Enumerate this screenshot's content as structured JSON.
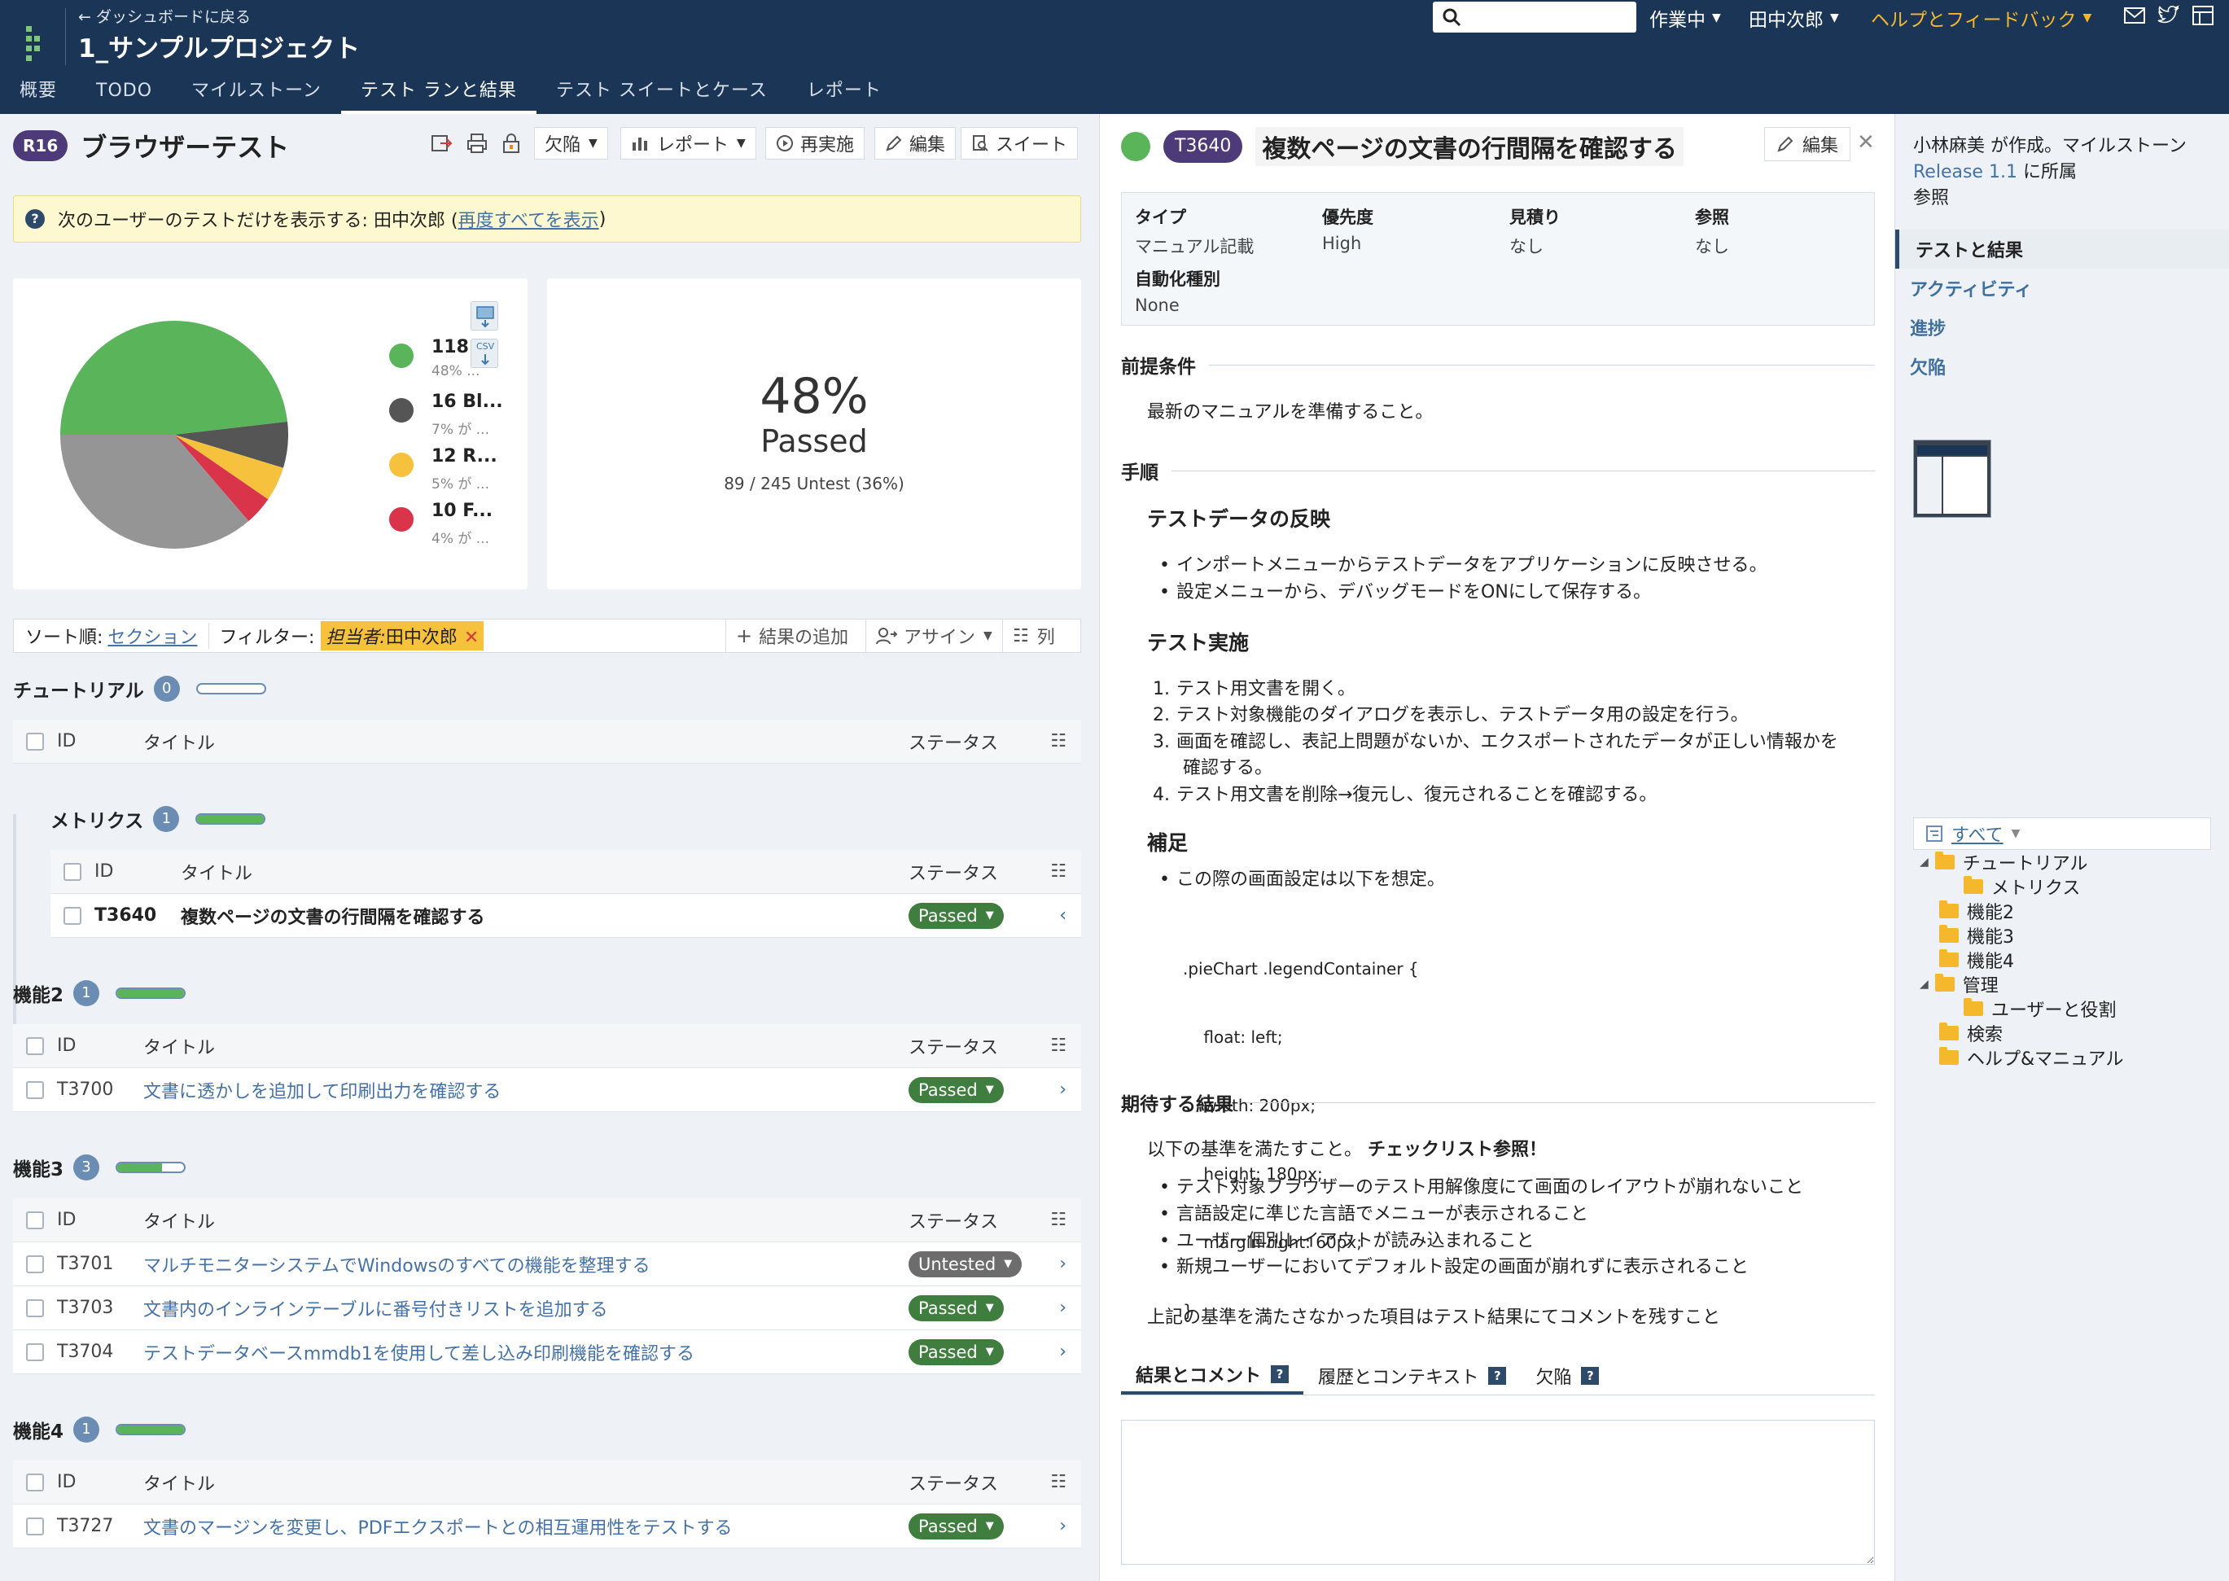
{
  "header": {
    "back": "← ダッシュボードに戻る",
    "project": "1_サンプルプロジェクト",
    "search_placeholder": "",
    "status": "作業中",
    "user": "田中次郎",
    "help": "ヘルプとフィードバック",
    "tabs": [
      "概要",
      "TODO",
      "マイルストーン",
      "テスト ランと結果",
      "テスト スイートとケース",
      "レポート"
    ]
  },
  "run": {
    "badge": "R16",
    "title": "ブラウザーテスト",
    "toolbar": {
      "defects": "欠陥",
      "report": "レポート",
      "rerun": "再実施",
      "edit": "編集",
      "suite": "スイート"
    },
    "notice_prefix": "次のユーザーのテストだけを表示する: 田中次郎 (",
    "notice_link": "再度すべてを表示",
    "notice_suffix": ")"
  },
  "chart_data": {
    "type": "pie",
    "slices": [
      {
        "label": "118 ...",
        "sub": "48% ...",
        "value": 118,
        "percent": 48,
        "color": "#5ab55a"
      },
      {
        "label": "16 Bl...",
        "sub": "7% が ...",
        "value": 16,
        "percent": 7,
        "color": "#555555"
      },
      {
        "label": "12 R...",
        "sub": "5% が ...",
        "value": 12,
        "percent": 5,
        "color": "#f6c23e"
      },
      {
        "label": "10 F...",
        "sub": "4% が ...",
        "value": 10,
        "percent": 4,
        "color": "#d9344a"
      },
      {
        "label": "",
        "sub": "",
        "value": 89,
        "percent": 36,
        "color": "#959595"
      }
    ],
    "export_labels": [
      "",
      "CSV"
    ]
  },
  "stats": {
    "percent": "48%",
    "label": "Passed",
    "untested": "89 / 245 Untest (36%)"
  },
  "filters": {
    "sort_label": "ソート順:",
    "sort_value": "セクション",
    "filter_label": "フィルター:",
    "chip_key": "担当者:",
    "chip_value": "田中次郎",
    "add_result": "結果の追加",
    "assign": "アサイン",
    "columns": "列"
  },
  "table_headers": {
    "id": "ID",
    "title": "タイトル",
    "status": "ステータス"
  },
  "sections": [
    {
      "name": "チュートリアル",
      "count": "0",
      "progress": 0,
      "rows": []
    },
    {
      "name": "メトリクス",
      "count": "1",
      "progress": 100,
      "rows": [
        {
          "id": "T3640",
          "title": "複数ページの文書の行間隔を確認する",
          "status": "Passed"
        }
      ]
    },
    {
      "name": "機能2",
      "count": "1",
      "progress": 100,
      "rows": [
        {
          "id": "T3700",
          "title": "文書に透かしを追加して印刷出力を確認する",
          "status": "Passed"
        }
      ]
    },
    {
      "name": "機能3",
      "count": "3",
      "progress": 67,
      "rows": [
        {
          "id": "T3701",
          "title": "マルチモニターシステムでWindowsのすべての機能を整理する",
          "status": "Untested"
        },
        {
          "id": "T3703",
          "title": "文書内のインラインテーブルに番号付きリストを追加する",
          "status": "Passed"
        },
        {
          "id": "T3704",
          "title": "テストデータベースmmdb1を使用して差し込み印刷機能を確認する",
          "status": "Passed"
        }
      ]
    },
    {
      "name": "機能4",
      "count": "1",
      "progress": 100,
      "rows": [
        {
          "id": "T3727",
          "title": "文書のマージンを変更し、PDFエクスポートとの相互運用性をテストする",
          "status": "Passed"
        }
      ]
    }
  ],
  "test": {
    "id": "T3640",
    "title": "複数ページの文書の行間隔を確認する",
    "edit": "編集",
    "props": [
      {
        "k": "タイプ",
        "v": "マニュアル記載"
      },
      {
        "k": "優先度",
        "v": "High"
      },
      {
        "k": "見積り",
        "v": "なし"
      },
      {
        "k": "参照",
        "v": "なし"
      },
      {
        "k": "自動化種別",
        "v": "None"
      }
    ],
    "precond_h": "前提条件",
    "precond": "最新のマニュアルを準備すること。",
    "steps_h": "手順",
    "sub1": "テストデータの反映",
    "sub1_items": [
      "インポートメニューからテストデータをアプリケーションに反映させる。",
      "設定メニューから、デバッグモードをONにして保存する。"
    ],
    "sub2": "テスト実施",
    "sub2_items": [
      "テスト用文書を開く。",
      "テスト対象機能のダイアログを表示し、テストデータ用の設定を行う。",
      "画面を確認し、表記上問題がないか、エクスポートされたデータが正しい情報かを",
      "確認する。",
      "テスト用文書を削除→復元し、復元されることを確認する。"
    ],
    "sub3": "補足",
    "sub3_item": "この際の画面設定は以下を想定。",
    "code": [
      ".pieChart .legendContainer {",
      "    float: left;",
      "    width: 200px;",
      "    height: 180px;",
      "    margin-right: 60px;",
      "}"
    ],
    "expected_h": "期待する結果",
    "expected_intro": "以下の基準を満たすこと。",
    "expected_bold": "チェックリスト参照！",
    "expected_items": [
      "テスト対象ブラウザーのテスト用解像度にて画面のレイアウトが崩れないこと",
      "言語設定に準じた言語でメニューが表示されること",
      "ユーザー個別レイアウトが読み込まれること",
      "新規ユーザーにおいてデフォルト設定の画面が崩れずに表示されること"
    ],
    "expected_note": "上記の基準を満たさなかった項目はテスト結果にてコメントを残すこと",
    "result_tabs": [
      "結果とコメント",
      "履歴とコンテキスト",
      "欠陥"
    ],
    "q": "?"
  },
  "sidebar": {
    "info1": "小林麻美 が作成。マイルストーン",
    "info_link": "Release 1.1",
    "info2": " に所属",
    "info3": "参照",
    "nav": [
      "テストと結果",
      "アクティビティ",
      "進捗",
      "欠陥"
    ],
    "tree_all": "すべて",
    "tree": [
      "チュートリアル",
      "メトリクス",
      "機能2",
      "機能3",
      "機能4",
      "管理",
      "ユーザーと役割",
      "検索",
      "ヘルプ&マニュアル"
    ]
  },
  "colors": {
    "header": "#1b3556",
    "passed": "#3f7e3f",
    "untested": "#6d6d6d",
    "accent": "#4d3a78",
    "help": "#f5b72c"
  }
}
